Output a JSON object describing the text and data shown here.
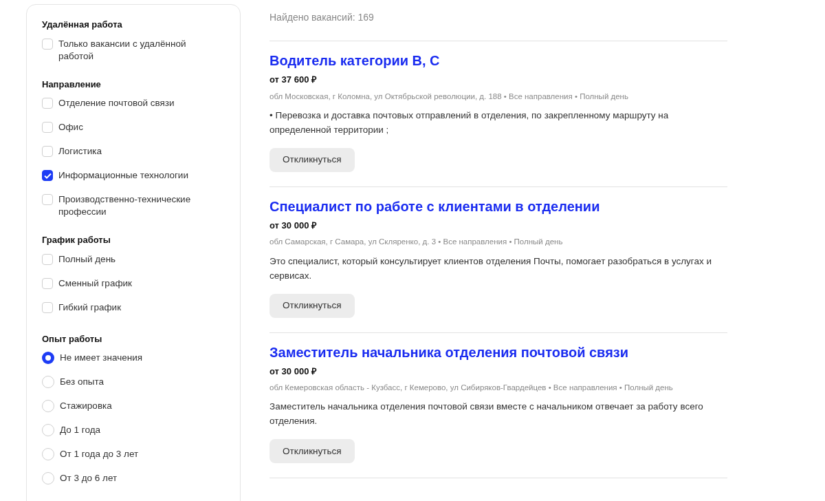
{
  "filters": [
    {
      "title": "Удалённая работа",
      "kind": "checkbox",
      "options": [
        {
          "label": "Только вакансии с удалённой работой",
          "checked": false
        }
      ]
    },
    {
      "title": "Направление",
      "kind": "checkbox",
      "options": [
        {
          "label": "Отделение почтовой связи",
          "checked": false
        },
        {
          "label": "Офис",
          "checked": false
        },
        {
          "label": "Логистика",
          "checked": false
        },
        {
          "label": "Информационные технологии",
          "checked": true
        },
        {
          "label": "Производственно-технические профессии",
          "checked": false
        }
      ]
    },
    {
      "title": "График работы",
      "kind": "checkbox",
      "options": [
        {
          "label": "Полный день",
          "checked": false
        },
        {
          "label": "Сменный график",
          "checked": false
        },
        {
          "label": "Гибкий график",
          "checked": false
        }
      ]
    },
    {
      "title": "Опыт работы",
      "kind": "radio",
      "options": [
        {
          "label": "Не имеет значения",
          "selected": true
        },
        {
          "label": "Без опыта",
          "selected": false
        },
        {
          "label": "Стажировка",
          "selected": false
        },
        {
          "label": "До 1 года",
          "selected": false
        },
        {
          "label": "От 1 года до 3 лет",
          "selected": false
        },
        {
          "label": "От 3 до 6 лет",
          "selected": false
        }
      ]
    }
  ],
  "results_count": "Найдено вакансий: 169",
  "vacancies": [
    {
      "title": "Водитель категории B, C",
      "salary": "от 37 600 ₽",
      "meta": "обл Московская, г Коломна, ул Октябрьской революции, д. 188 • Все направления • Полный день",
      "description": "• Перевозка и доставка почтовых отправлений в отделения, по закрепленному маршруту на определенной территории ;",
      "button": "Откликнуться"
    },
    {
      "title": "Специалист по работе с клиентами в отделении",
      "salary": "от 30 000 ₽",
      "meta": "обл Самарская, г Самара, ул Скляренко, д. 3 • Все направления • Полный день",
      "description": "Это специалист, который консультирует клиентов отделения Почты, помогает разобраться в услугах и сервисах.",
      "button": "Откликнуться"
    },
    {
      "title": "Заместитель начальника отделения почтовой связи",
      "salary": "от 30 000 ₽",
      "meta": "обл Кемеровская область - Кузбасс, г Кемерово, ул Сибиряков-Гвардейцев • Все направления • Полный день",
      "description": "Заместитель начальника отделения почтовой связи вместе с начальником отвечает за работу всего отделения.",
      "button": "Откликнуться"
    }
  ]
}
